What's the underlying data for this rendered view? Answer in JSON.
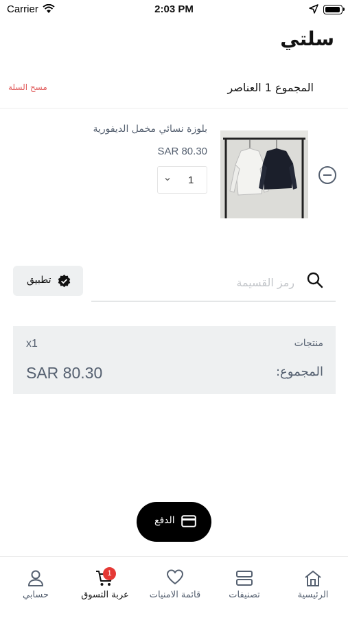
{
  "status_bar": {
    "carrier": "Carrier",
    "time": "2:03 PM"
  },
  "header": {
    "title": "سلتي"
  },
  "summary": {
    "clear_cart": "مسح السلة",
    "total_items": "المجموع 1 العناصر"
  },
  "cart_items": [
    {
      "name": "بلوزة نسائي مخمل الديفورية",
      "price": "SAR 80.30",
      "quantity": "1"
    }
  ],
  "coupon": {
    "placeholder": "رمز القسيمة",
    "apply_label": "تطبيق"
  },
  "totals": {
    "items_label": "منتجات",
    "items_count": "x1",
    "total_label": "المجموع:",
    "total_value": "SAR 80.30"
  },
  "checkout": {
    "label": "الدفع"
  },
  "nav": {
    "items": [
      {
        "label": "الرئيسية",
        "icon": "home-icon"
      },
      {
        "label": "تصنيفات",
        "icon": "categories-icon"
      },
      {
        "label": "قائمة الامنيات",
        "icon": "heart-icon"
      },
      {
        "label": "عربة التسوق",
        "icon": "cart-icon",
        "badge": "1"
      },
      {
        "label": "حسابي",
        "icon": "user-icon"
      }
    ]
  },
  "colors": {
    "accent": "#000000",
    "text_muted": "#556070",
    "danger": "#e05a5a",
    "badge": "#e53935",
    "panel": "#eef0f1"
  }
}
